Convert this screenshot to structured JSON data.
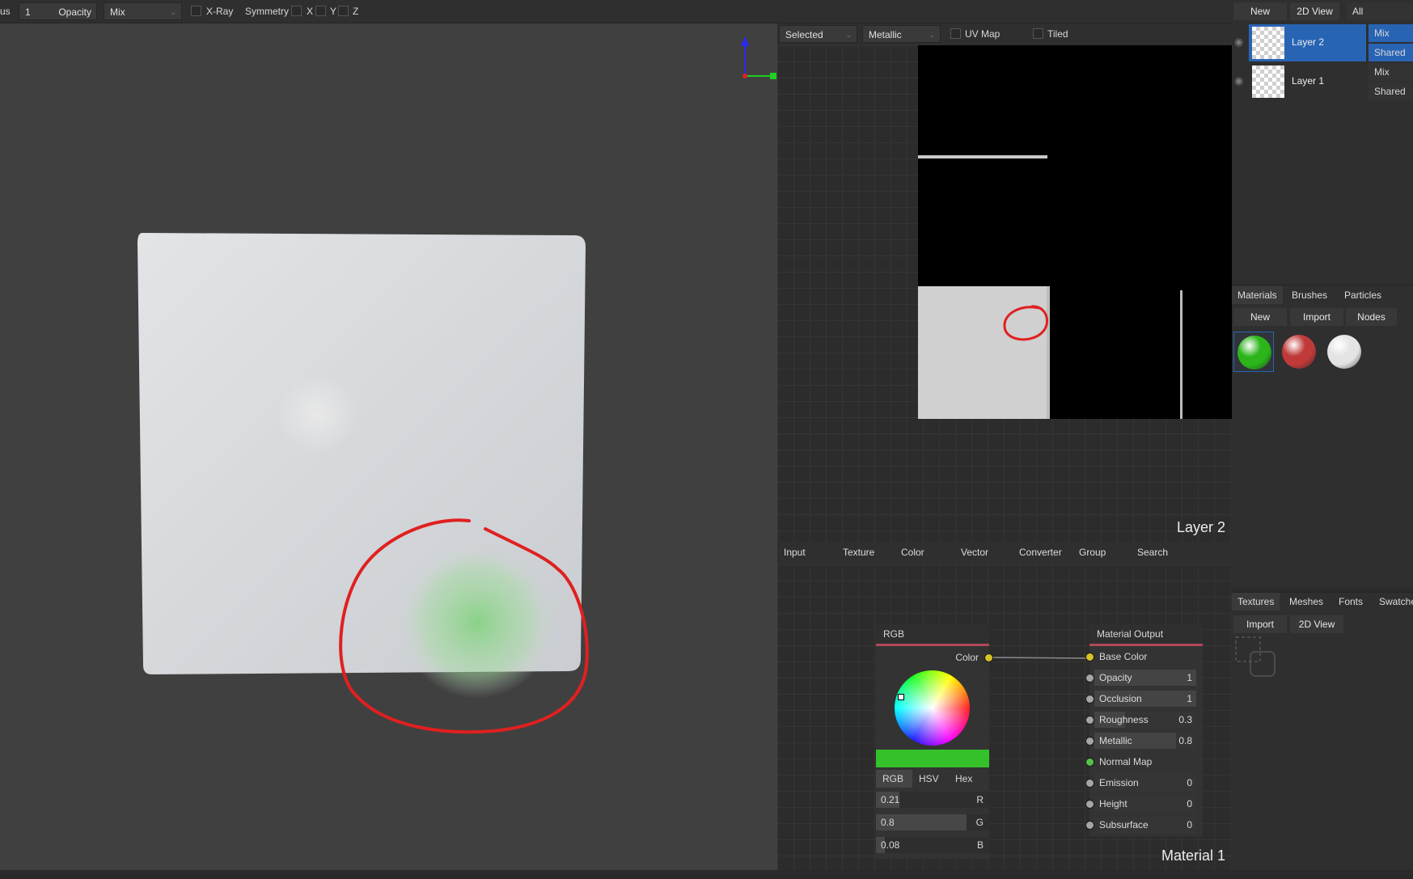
{
  "toolbar": {
    "partial_label": "us",
    "opacity_value": "1",
    "opacity_label": "Opacity",
    "blend": "Mix",
    "xray_label": "X-Ray",
    "symmetry_label": "Symmetry",
    "x_label": "X",
    "y_label": "Y",
    "z_label": "Z"
  },
  "view2d": {
    "filter": "Selected",
    "channel": "Metallic",
    "uvmap_label": "UV Map",
    "tiled_label": "Tiled",
    "layer_title": "Layer 2"
  },
  "layers": {
    "new_label": "New",
    "view2d_label": "2D View",
    "filter": "All",
    "items": [
      {
        "name": "Layer 2",
        "blend": "Mix",
        "scope": "Shared",
        "selected": true
      },
      {
        "name": "Layer 1",
        "blend": "Mix",
        "scope": "Shared",
        "selected": false
      }
    ]
  },
  "materials_panel": {
    "tabs": [
      "Materials",
      "Brushes",
      "Particles"
    ],
    "buttons": [
      "New",
      "Import",
      "Nodes"
    ],
    "swatches": [
      {
        "icon": "green-material-sphere",
        "color": "#2bb51a"
      },
      {
        "icon": "red-material-sphere",
        "color": "#c03a3a"
      },
      {
        "icon": "white-material-sphere",
        "color": "#e4e4e4"
      }
    ]
  },
  "textures_panel": {
    "tabs": [
      "Textures",
      "Meshes",
      "Fonts",
      "Swatches"
    ],
    "buttons": [
      "Import",
      "2D View"
    ]
  },
  "node_menu": [
    "Input",
    "Texture",
    "Color",
    "Vector",
    "Converter",
    "Group",
    "Search"
  ],
  "rgb_node": {
    "title": "RGB",
    "output_label": "Color",
    "swatch_color": "#35c12a",
    "modes": [
      "RGB",
      "HSV",
      "Hex"
    ],
    "channels": [
      {
        "value": "0.21",
        "label": "R",
        "level": 0.21
      },
      {
        "value": "0.8",
        "label": "G",
        "level": 0.8
      },
      {
        "value": "0.08",
        "label": "B",
        "level": 0.08
      }
    ]
  },
  "output_node": {
    "title": "Material Output",
    "inputs": [
      {
        "label": "Base Color",
        "value": "",
        "socket": "#d6c324",
        "level": null
      },
      {
        "label": "Opacity",
        "value": "1",
        "socket": "#a6a6a6",
        "level": 1
      },
      {
        "label": "Occlusion",
        "value": "1",
        "socket": "#a6a6a6",
        "level": 1
      },
      {
        "label": "Roughness",
        "value": "0.3",
        "socket": "#a6a6a6",
        "level": 0.3
      },
      {
        "label": "Metallic",
        "value": "0.8",
        "socket": "#a6a6a6",
        "level": 0.8
      },
      {
        "label": "Normal Map",
        "value": "",
        "socket": "#57c24a",
        "level": null
      },
      {
        "label": "Emission",
        "value": "0",
        "socket": "#a6a6a6",
        "level": 0
      },
      {
        "label": "Height",
        "value": "0",
        "socket": "#a6a6a6",
        "level": 0
      },
      {
        "label": "Subsurface",
        "value": "0",
        "socket": "#a6a6a6",
        "level": 0
      }
    ]
  },
  "material_title": "Material 1"
}
